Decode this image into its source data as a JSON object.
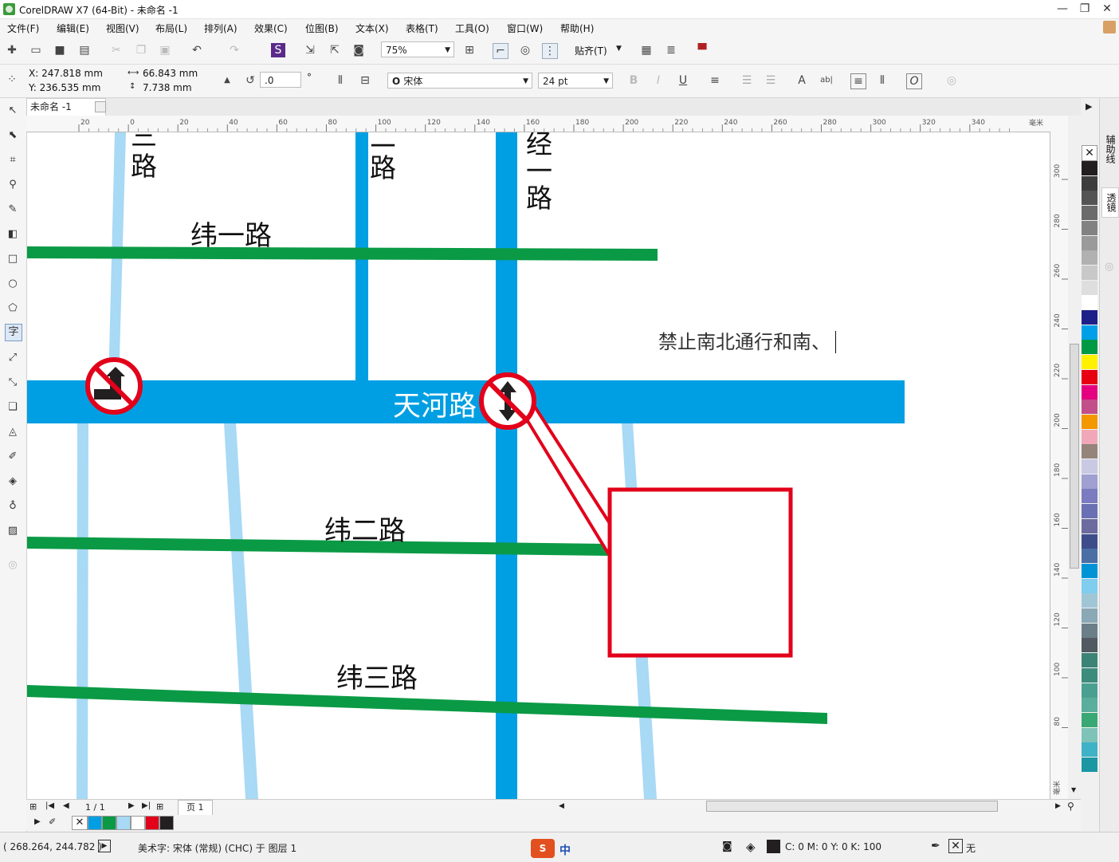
{
  "window": {
    "title": "CorelDRAW X7 (64-Bit) - 未命名 -1",
    "minimize": "—",
    "restore": "❐",
    "close": "✕"
  },
  "menu": [
    "文件(F)",
    "编辑(E)",
    "视图(V)",
    "布局(L)",
    "排列(A)",
    "效果(C)",
    "位图(B)",
    "文本(X)",
    "表格(T)",
    "工具(O)",
    "窗口(W)",
    "帮助(H)"
  ],
  "toolbar": {
    "zoom": "75%",
    "snap": "贴齐(T)"
  },
  "propbar": {
    "x": "X: 247.818 mm",
    "y": "Y: 236.535 mm",
    "width": "66.843 mm",
    "height": "7.738 mm",
    "angle": ".0",
    "degree": "°",
    "font": "宋体",
    "font_size": "24 pt"
  },
  "doc_tab": "未命名 -1",
  "ruler": {
    "h_ticks": [
      "20",
      "0",
      "20",
      "40",
      "60",
      "80",
      "100",
      "120",
      "140",
      "160",
      "180",
      "200",
      "220",
      "240",
      "260",
      "280",
      "300",
      "320",
      "340"
    ],
    "h_unit": "毫米",
    "v_ticks": [
      "300",
      "280",
      "260",
      "240",
      "220",
      "200",
      "180",
      "160",
      "140",
      "120",
      "100",
      "80"
    ],
    "v_unit": "毫米"
  },
  "map": {
    "labels": {
      "jing3": "三\n路",
      "jing2": "二\n路",
      "jing1": "经\n一\n路",
      "wei1": "纬一路",
      "tianhe": "天河路",
      "wei2": "纬二路",
      "wei3": "纬三路"
    },
    "edit_text": "禁止南北通行和南、",
    "colors": {
      "green": "#0a9a45",
      "blue": "#009fe3",
      "lightblue": "#a8d9f5",
      "red": "#e2001a"
    }
  },
  "palette_colors": [
    "#231f20",
    "#3d3d3d",
    "#545454",
    "#6b6b6b",
    "#828282",
    "#9a9a9a",
    "#b1b1b1",
    "#c8c8c8",
    "#dedede",
    "#ffffff",
    "#1d2088",
    "#00a0e9",
    "#009944",
    "#fff100",
    "#e60012",
    "#e4007f",
    "#c24f89",
    "#f39800",
    "#f0a8b8",
    "#94847a",
    "#c9c9e4",
    "#9f9fd1",
    "#7b7bc0",
    "#6a70b3",
    "#6b6b9f",
    "#3e4d8a",
    "#4a6fa5",
    "#0094d7",
    "#7fcdef",
    "#a0c6d6",
    "#8aa8b5",
    "#6b7f88",
    "#505a60",
    "#3b8375",
    "#3c8c7c",
    "#4aa090",
    "#5cae9c",
    "#3aa874",
    "#7ec3b8",
    "#3fb2c6",
    "#1a97a3"
  ],
  "pagebar": {
    "counter": "1 / 1",
    "page_tab": "页 1"
  },
  "doc_palette": [
    "#009fe3",
    "#0a9a45",
    "#a8d9f5",
    "#ffffff",
    "#e2001a",
    "#231f20"
  ],
  "status": {
    "coords": "( 268.264, 244.782 )",
    "info": "美术字: 宋体 (常规) (CHC) 于 图层 1",
    "fill": "C: 0 M: 0 Y: 0 K: 100",
    "outline": "无",
    "ime": "中"
  },
  "dockers": [
    "辅助线",
    "透镜"
  ]
}
